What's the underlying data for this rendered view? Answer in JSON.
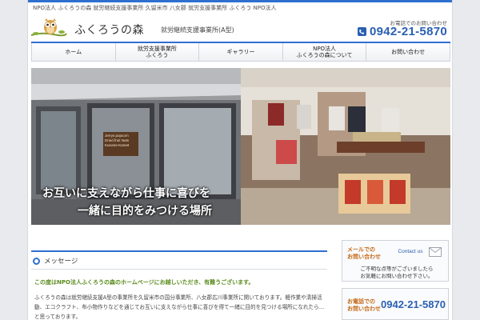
{
  "header": {
    "tagline": "NPO法人 ふくろうの森 就労継続支援事業所 久留米市 八女郡 就労支援事業所 ふくろう NPO法人",
    "site_name": "ふくろうの森",
    "site_subtitle": "就労継続支援事業所(A型)",
    "phone_label": "お電話でのお問い合わせ",
    "phone_number": "0942-21-5870",
    "logo_icon": "owl-on-branch-logo"
  },
  "nav": {
    "items": [
      {
        "label": "ホーム"
      },
      {
        "label": "就労支援事業所\nふくろう"
      },
      {
        "label": "ギャラリー"
      },
      {
        "label": "NPO法人\nふくろうの森について"
      },
      {
        "label": "お問い合わせ"
      }
    ]
  },
  "hero": {
    "caption_line1": "お互いに支えながら仕事に喜びを",
    "caption_line2": "一緒に目的をみつける場所",
    "shop_sign": "Jerrys popcorn\nDried fruit  Nuts\nKurume-Kamet"
  },
  "message": {
    "heading": "メッセージ",
    "lead": "この度はNPO法人ふくろうの森のホームページにお越しいただき、有難うございます。",
    "body": "ふくろうの森は就労継続支援A型の事業所を久留米市の国分事業所、八女郡広川事業所に開いております。軽作業や清掃活動、エコクラフト、布小物作りなどを通じてお互いに支えながら仕事に喜びを得て一緒に目的を見つける場所になれたら…と思っております。"
  },
  "sidebar": {
    "mail_title": "メールでの\nお問い合わせ",
    "mail_button": "Contact us",
    "mail_note": "ご不明な点等がございましたら\nお気軽にお問い合わせ下さい。",
    "tel_title": "お電話での\nお問い合わせ",
    "tel_number": "0942-21-5870"
  },
  "colors": {
    "accent": "#2f6fd0",
    "phone_blue": "#2a5fb3",
    "lead_green": "#5b8c1e",
    "sidebar_orange": "#c56a1a"
  }
}
